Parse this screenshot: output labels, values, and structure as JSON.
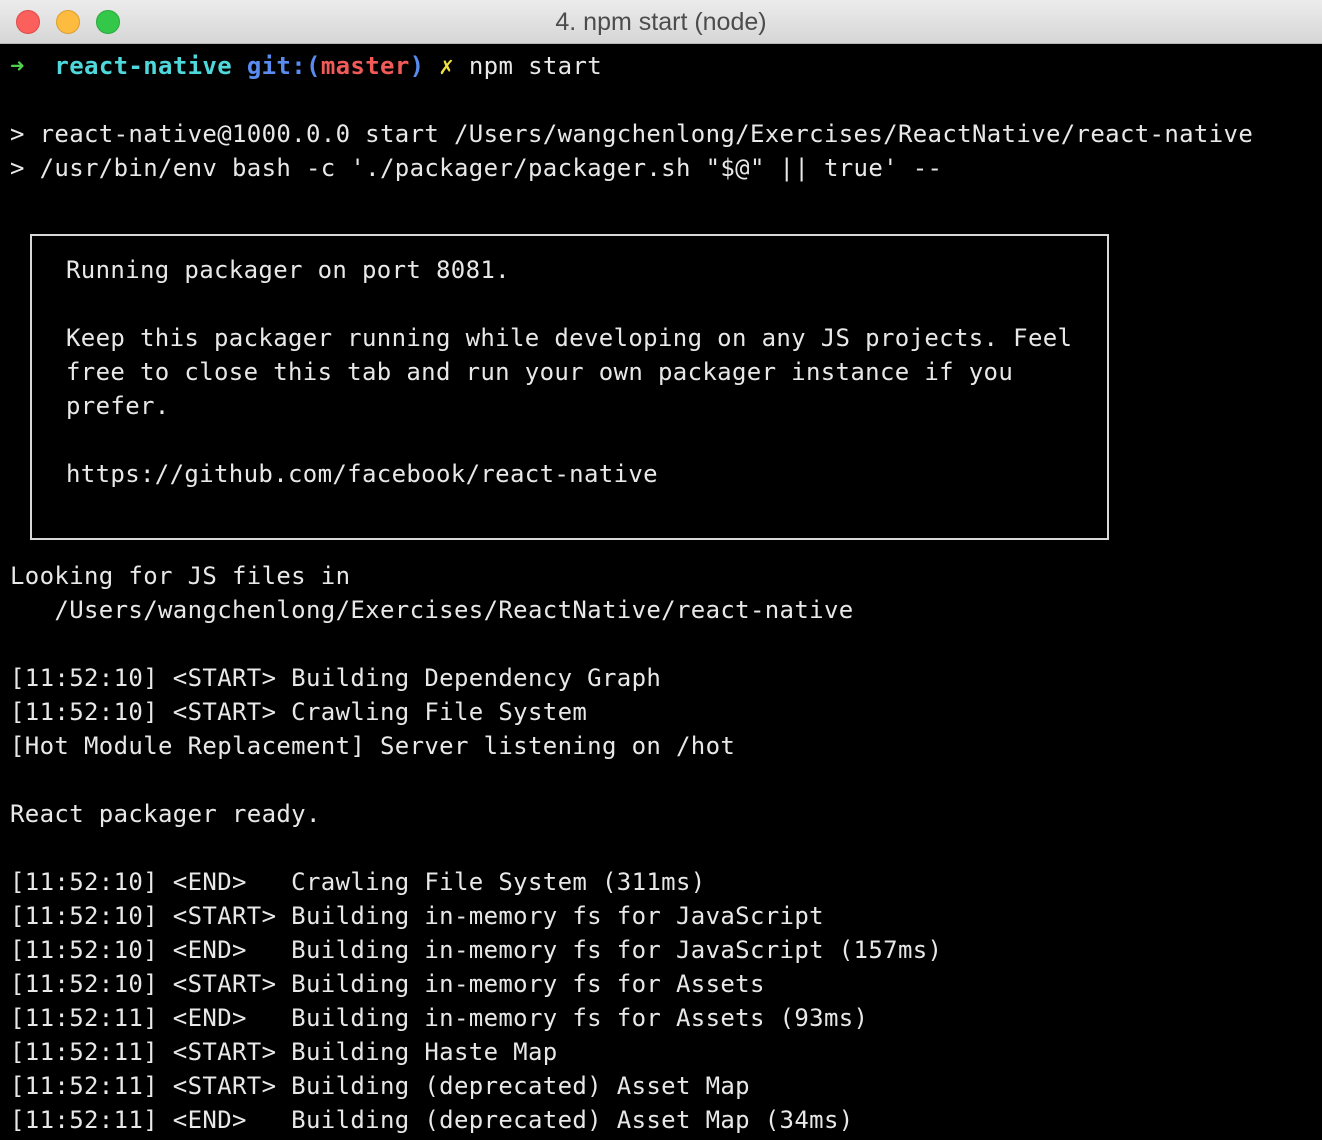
{
  "window": {
    "title": "4. npm start (node)"
  },
  "prompt": {
    "arrow": "➜",
    "directory": "react-native",
    "git_label": "git:(",
    "branch": "master",
    "git_close": ")",
    "dirty_mark": "✗",
    "command": "npm start"
  },
  "script_lines": [
    "> react-native@1000.0.0 start /Users/wangchenlong/Exercises/ReactNative/react-native",
    "> /usr/bin/env bash -c './packager/packager.sh \"$@\" || true' --"
  ],
  "banner": {
    "port_line": "Running packager on port 8081.",
    "message_line1": "Keep this packager running while developing on any JS projects. Feel",
    "message_line2": "free to close this tab and run your own packager instance if you",
    "message_line3": "prefer.",
    "url": "https://github.com/facebook/react-native"
  },
  "looking": {
    "label": "Looking for JS files in",
    "path": "   /Users/wangchenlong/Exercises/ReactNative/react-native"
  },
  "log_block1": [
    "[11:52:10] <START> Building Dependency Graph",
    "[11:52:10] <START> Crawling File System",
    "[Hot Module Replacement] Server listening on /hot"
  ],
  "ready": "React packager ready.",
  "log_block2": [
    "[11:52:10] <END>   Crawling File System (311ms)",
    "[11:52:10] <START> Building in-memory fs for JavaScript",
    "[11:52:10] <END>   Building in-memory fs for JavaScript (157ms)",
    "[11:52:10] <START> Building in-memory fs for Assets",
    "[11:52:11] <END>   Building in-memory fs for Assets (93ms)",
    "[11:52:11] <START> Building Haste Map",
    "[11:52:11] <START> Building (deprecated) Asset Map",
    "[11:52:11] <END>   Building (deprecated) Asset Map (34ms)"
  ],
  "colors": {
    "background": "#000000",
    "text": "#e8e8e8",
    "arrow": "#4fd04f",
    "directory": "#4fd8dc",
    "git": "#5a8cf0",
    "branch": "#f25a5a",
    "dirty": "#f0e040"
  }
}
